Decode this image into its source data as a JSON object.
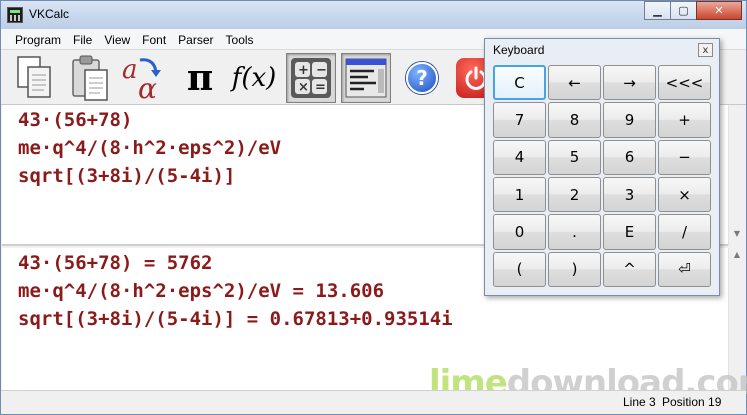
{
  "window": {
    "title": "VKCalc"
  },
  "menu": [
    "Program",
    "File",
    "View",
    "Font",
    "Parser",
    "Tools"
  ],
  "toolbar": {
    "tools": [
      {
        "name": "copy-tool",
        "icon": "copy-documents-icon"
      },
      {
        "name": "paste-tool",
        "icon": "clipboard-icon"
      },
      {
        "name": "symbols-tool",
        "icon": "greek-alpha-icon"
      },
      {
        "name": "constants-tool",
        "icon": "pi-icon"
      },
      {
        "name": "functions-tool",
        "icon": "function-icon"
      },
      {
        "name": "keyboard-tool",
        "icon": "calculator-keys-icon"
      },
      {
        "name": "output-panel-tool",
        "icon": "panel-layout-icon"
      },
      {
        "name": "help-tool",
        "icon": "help-icon"
      },
      {
        "name": "exit-tool",
        "icon": "power-icon"
      }
    ],
    "pi_glyph": "π",
    "fx_glyph": "f(x)",
    "help_glyph": "?"
  },
  "input_lines": [
    "43·(56+78)",
    "me·q^4/(8·h^2·eps^2)/eV",
    "sqrt[(3+8i)/(5-4i)]"
  ],
  "output_lines": [
    "43·(56+78) = 5762",
    "me·q^4/(8·h^2·eps^2)/eV = 13.606",
    "sqrt[(3+8i)/(5-4i)] = 0.67813+0.93514i"
  ],
  "status": {
    "line": "Line 3",
    "position": "Position 19"
  },
  "watermark": {
    "part1": "lime",
    "part2": "download.com"
  },
  "keyboard": {
    "title": "Keyboard",
    "close_glyph": "x",
    "keys": [
      [
        "C",
        "←",
        "→",
        "<<<"
      ],
      [
        "7",
        "8",
        "9",
        "+"
      ],
      [
        "4",
        "5",
        "6",
        "−"
      ],
      [
        "1",
        "2",
        "3",
        "×"
      ],
      [
        "0",
        ".",
        "E",
        "/"
      ],
      [
        "(",
        ")",
        "^",
        "⏎"
      ]
    ]
  },
  "colors": {
    "expression_text": "#8b1a1a",
    "focus_border": "#48a3e6"
  }
}
